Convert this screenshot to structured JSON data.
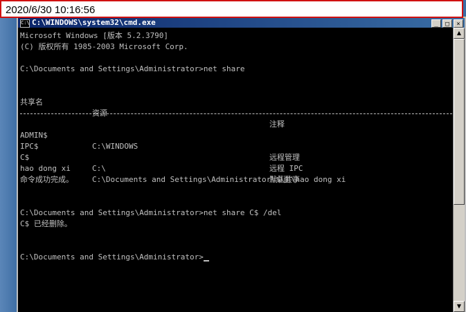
{
  "timestamp": "2020/6/30 10:16:56",
  "window": {
    "title": "C:\\WINDOWS\\system32\\cmd.exe",
    "icon_label": "C:\\",
    "minimize_label": "_",
    "maximize_label": "□",
    "close_label": "×"
  },
  "console": {
    "line1": "Microsoft Windows [版本 5.2.3790]",
    "line2": "(C) 版权所有 1985-2003 Microsoft Corp.",
    "prompt1": "C:\\Documents and Settings\\Administrator>net share",
    "headers": {
      "name": "共享名",
      "resource": "资源",
      "remark": "注释"
    },
    "shares": [
      {
        "name": "ADMIN$",
        "resource": "C:\\WINDOWS",
        "remark": "远程管理"
      },
      {
        "name": "IPC$",
        "resource": "",
        "remark": "远程 IPC"
      },
      {
        "name": "C$",
        "resource": "C:\\",
        "remark": "默认共享"
      },
      {
        "name": "hao dong xi",
        "resource": "C:\\Documents and Settings\\Administrator\\桌面\\hao dong xi",
        "remark": ""
      }
    ],
    "success": "命令成功完成。",
    "prompt2": "C:\\Documents and Settings\\Administrator>net share C$ /del",
    "deleted": "C$ 已经删除。",
    "prompt3": "C:\\Documents and Settings\\Administrator>"
  },
  "colors": {
    "console_background": "#000000",
    "console_text": "#c0c0c0",
    "titlebar": "#0a246a",
    "timestamp_border": "#d01010"
  },
  "icons": [
    "cmd-icon",
    "minimize-icon",
    "maximize-icon",
    "close-icon",
    "scroll-up-icon",
    "scroll-down-icon"
  ]
}
